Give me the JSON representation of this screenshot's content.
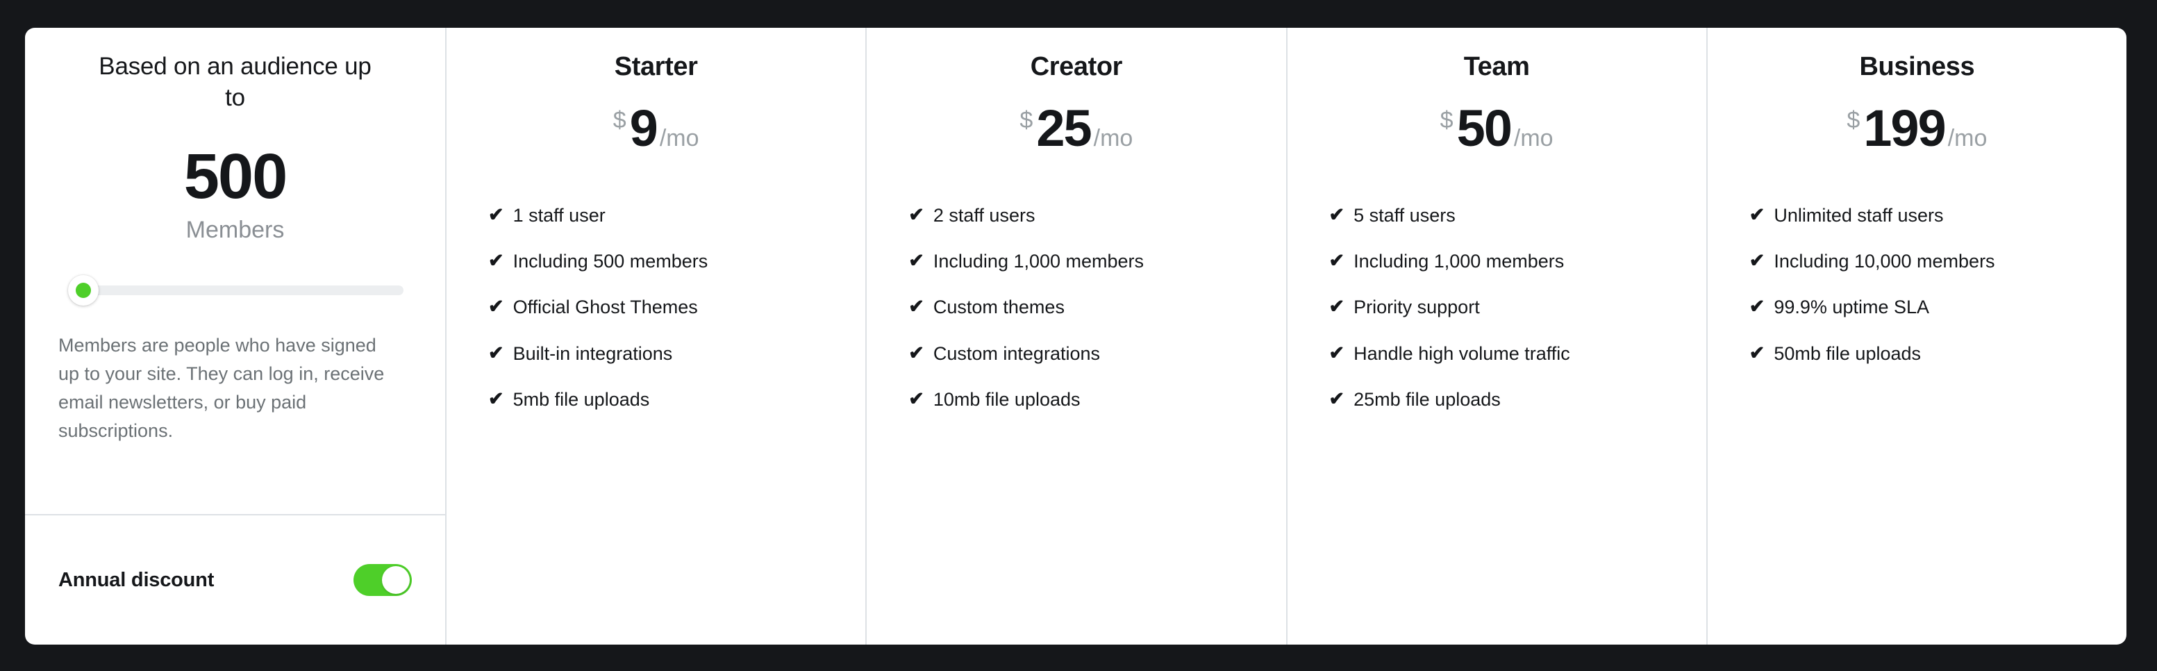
{
  "audience": {
    "heading": "Based on an audience up to",
    "count": "500",
    "count_label": "Members",
    "description": "Members are people who have signed up to your site. They can log in, receive email newsletters, or buy paid subscriptions.",
    "slider": {
      "value": "500",
      "position_percent": 0
    },
    "annual_discount": {
      "label": "Annual discount",
      "enabled": "on"
    }
  },
  "colors": {
    "page_background": "#15171A",
    "card_background": "#ffffff",
    "accent_green": "#4ecf29",
    "divider": "#dde1e5",
    "muted_text": "#8a8f94",
    "body_text": "#15171A"
  },
  "plans": [
    {
      "name": "Starter",
      "currency": "$",
      "amount": "9",
      "period": "/mo",
      "features": [
        "1 staff user",
        "Including 500 members",
        "Official Ghost Themes",
        "Built-in integrations",
        "5mb file uploads"
      ]
    },
    {
      "name": "Creator",
      "currency": "$",
      "amount": "25",
      "period": "/mo",
      "features": [
        "2 staff users",
        "Including 1,000 members",
        "Custom themes",
        "Custom integrations",
        "10mb file uploads"
      ]
    },
    {
      "name": "Team",
      "currency": "$",
      "amount": "50",
      "period": "/mo",
      "features": [
        "5 staff users",
        "Including 1,000 members",
        "Priority support",
        "Handle high volume traffic",
        "25mb file uploads"
      ]
    },
    {
      "name": "Business",
      "currency": "$",
      "amount": "199",
      "period": "/mo",
      "features": [
        "Unlimited staff users",
        "Including 10,000 members",
        "99.9% uptime SLA",
        "50mb file uploads"
      ]
    }
  ],
  "icons": {
    "check": "✔"
  }
}
